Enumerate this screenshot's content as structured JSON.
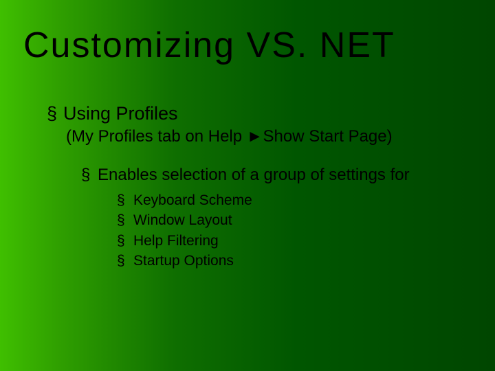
{
  "title": "Customizing VS. NET",
  "lvl1": {
    "bullet": "§",
    "text": "Using Profiles",
    "subnote": "(My Profiles tab on Help ►Show Start Page)"
  },
  "lvl2": {
    "bullet": "§",
    "text": "Enables selection of a group of settings for"
  },
  "lvl3": {
    "bullet": "§",
    "items": [
      "Keyboard Scheme",
      "Window Layout",
      "Help Filtering",
      "Startup Options"
    ]
  }
}
